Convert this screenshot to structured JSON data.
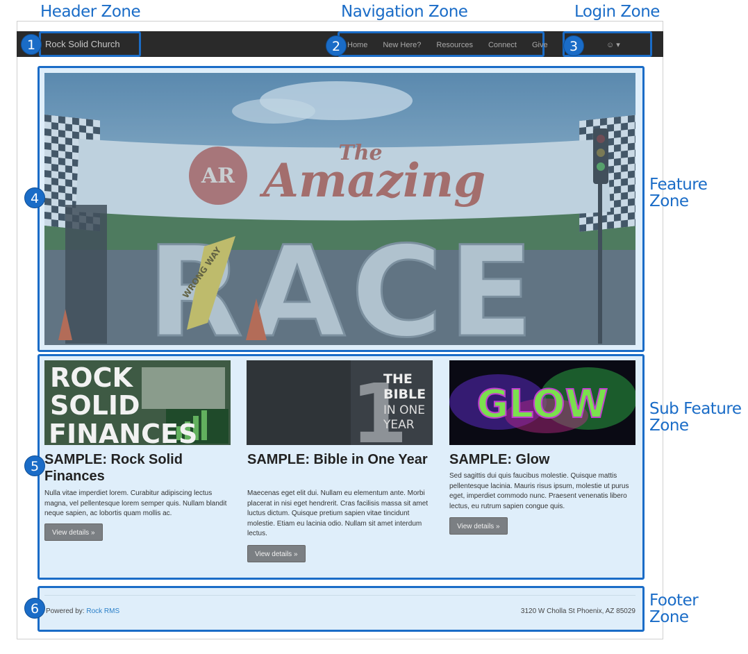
{
  "zones": {
    "header": "Header Zone",
    "navigation": "Navigation Zone",
    "login": "Login Zone",
    "feature_line1": "Feature",
    "feature_line2": "Zone",
    "subfeature_line1": "Sub Feature",
    "subfeature_line2": "Zone",
    "footer_line1": "Footer",
    "footer_line2": "Zone"
  },
  "badges": [
    "1",
    "2",
    "3",
    "4",
    "5",
    "6"
  ],
  "site": {
    "brand": "Rock Solid Church",
    "nav_items": [
      "Home",
      "New Here?",
      "Resources",
      "Connect",
      "Give"
    ],
    "user_menu": "☺ ▾"
  },
  "hero": {
    "line1": "The",
    "line2": "Amazing",
    "line3": "RACE",
    "sign": "WRONG WAY"
  },
  "cards": [
    {
      "image_text": [
        "ROCK",
        "SOLID",
        "FINANCES"
      ],
      "title": "SAMPLE: Rock Solid Finances",
      "body": "Nulla vitae imperdiet lorem. Curabitur adipiscing lectus magna, vel pellentesque lorem semper quis. Nullam blandit neque sapien, ac lobortis quam mollis ac.",
      "button": "View details »"
    },
    {
      "image_text": [
        "1",
        "THE",
        "BIBLE",
        "IN ONE",
        "YEAR"
      ],
      "title": "SAMPLE: Bible in One Year",
      "body": "Maecenas eget elit dui. Nullam eu elementum ante. Morbi placerat in nisi eget hendrerit. Cras facilisis massa sit amet luctus dictum. Quisque pretium sapien vitae tincidunt molestie. Etiam eu lacinia odio. Nullam sit amet interdum lectus.",
      "button": "View details »"
    },
    {
      "image_text": [
        "GLOW"
      ],
      "title": "SAMPLE: Glow",
      "body": "Sed sagittis dui quis faucibus molestie. Quisque mattis pellentesque lacinia. Mauris risus ipsum, molestie ut purus eget, imperdiet commodo nunc. Praesent venenatis libero lectus, eu rutrum sapien congue quis.",
      "button": "View details »"
    }
  ],
  "footer": {
    "powered_label": "Powered by: ",
    "powered_link": "Rock RMS",
    "address": "3120 W Cholla St Phoenix, AZ 85029"
  },
  "colors": {
    "accent": "#1a6cc7",
    "zone_fill": "#dfeefa",
    "navbar": "#2a2a2a"
  }
}
